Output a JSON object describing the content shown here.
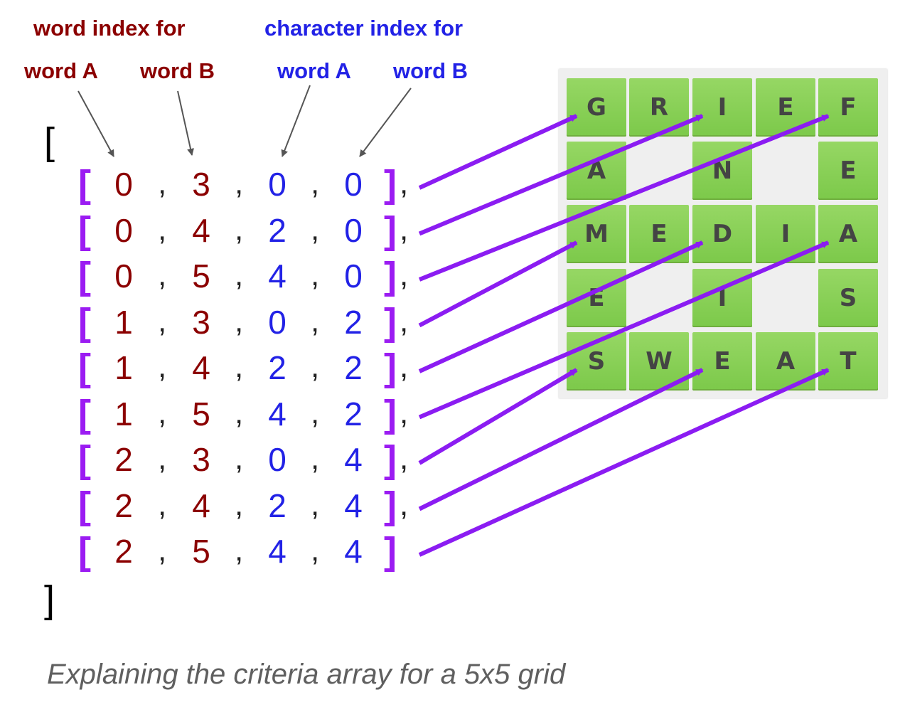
{
  "headers": {
    "word_index": "word index for",
    "char_index": "character index for",
    "word_a_red": "word A",
    "word_b_red": "word B",
    "word_a_blue": "word A",
    "word_b_blue": "word B"
  },
  "array": {
    "open": "[",
    "close": "]",
    "row_open": "[",
    "row_close": "]",
    "comma": ",",
    "rows": [
      [
        0,
        3,
        0,
        0
      ],
      [
        0,
        4,
        2,
        0
      ],
      [
        0,
        5,
        4,
        0
      ],
      [
        1,
        3,
        0,
        2
      ],
      [
        1,
        4,
        2,
        2
      ],
      [
        1,
        5,
        4,
        2
      ],
      [
        2,
        3,
        0,
        4
      ],
      [
        2,
        4,
        2,
        4
      ],
      [
        2,
        5,
        4,
        4
      ]
    ]
  },
  "grid": [
    [
      "G",
      "R",
      "I",
      "E",
      "F"
    ],
    [
      "A",
      "",
      "N",
      "",
      "E"
    ],
    [
      "M",
      "E",
      "D",
      "I",
      "A"
    ],
    [
      "E",
      "",
      "I",
      "",
      "S"
    ],
    [
      "S",
      "W",
      "E",
      "A",
      "T"
    ]
  ],
  "caption": "Explaining the criteria array for a 5x5 grid",
  "colors": {
    "word_index": "#8b0000",
    "char_index": "#2222e6",
    "bracket": "#9b1cf2",
    "arrow": "#8b1cf2",
    "tile": "#8ccf58",
    "grid_bg": "#efefef"
  }
}
